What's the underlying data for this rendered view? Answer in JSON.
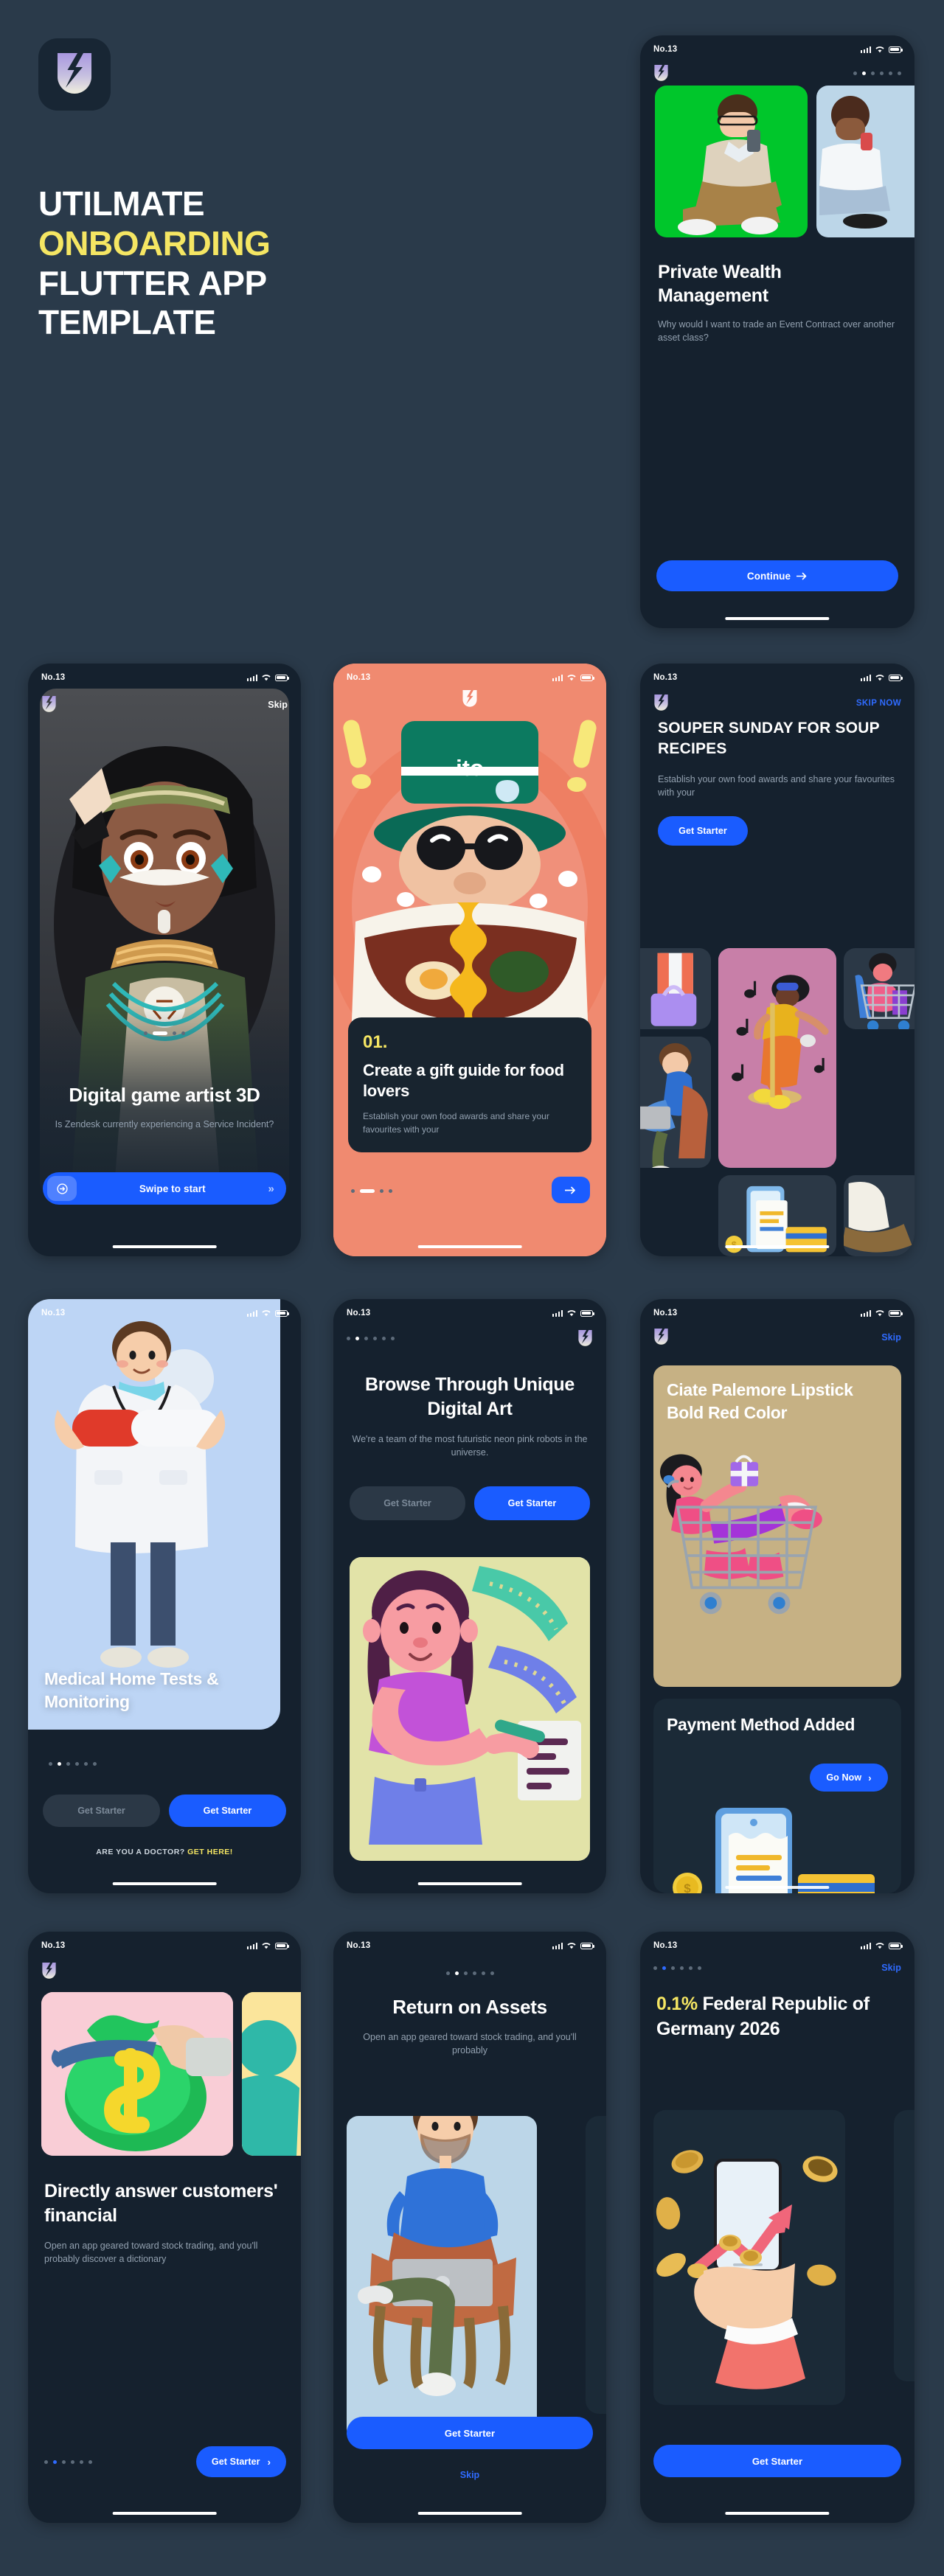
{
  "hero": {
    "logo_icon": "lightning-u-logo-icon",
    "title_line1": "UTILMATE",
    "title_line2": "ONBOARDING",
    "title_line3": "FLUTTER APP",
    "title_line4": "TEMPLATE",
    "accent_color": "#f5e663"
  },
  "theme": {
    "page_bg": "#2a3a4a",
    "phone_bg": "#15212e",
    "primary": "#1a5cff",
    "link_blue": "#2f6bff",
    "yellow": "#f5e663",
    "muted_text": "#93a1b0"
  },
  "status_bar": {
    "label": "No.13",
    "signal_icon": "signal-bars-icon",
    "wifi_icon": "wifi-icon",
    "battery_icon": "battery-full-icon"
  },
  "screens": [
    {
      "id": "private-wealth",
      "brand_icon": "app-logo-icon",
      "dots": {
        "count": 6,
        "active": 1
      },
      "gallery": [
        {
          "bg": "#00c62b",
          "label": "man-with-phone-green-card"
        },
        {
          "bg": "#bcd6e8",
          "label": "woman-with-phone-blue-card"
        }
      ],
      "title": "Private Wealth Management",
      "subtitle": "Why would I want to trade an Event Contract over another asset class?",
      "cta": {
        "label": "Continue",
        "icon": "arrow-right-icon"
      }
    },
    {
      "id": "digital-game-artist",
      "brand_icon": "app-logo-icon",
      "skip_label": "Skip",
      "hero_label": "native-girl-3d-portrait",
      "dots": {
        "count": 5,
        "active": 1,
        "style": "pill"
      },
      "title": "Digital game artist 3D",
      "subtitle": "Is Zendesk currently experiencing a Service Incident?",
      "cta": {
        "label": "Swipe to start",
        "lead_icon": "arrow-circle-right-icon",
        "trail_icon": "chevron-double-right-icon"
      }
    },
    {
      "id": "gift-guide-food",
      "brand_icon": "app-logo-icon",
      "hero_label": "ramen-man-with-bucket-hat-ito",
      "step": "01.",
      "title": "Create a gift guide for food lovers",
      "subtitle": "Establish your own food awards and share your favourites with your",
      "dots": {
        "count": 4,
        "active": 1,
        "style": "pill"
      },
      "next_button": {
        "icon": "arrow-right-icon"
      }
    },
    {
      "id": "souper-sunday",
      "brand_icon": "app-logo-icon",
      "skip_label": "SKIP NOW",
      "title": "SOUPER SUNDAY FOR SOUP RECIPES",
      "subtitle": "Establish your own food awards and share your favourites with your",
      "cta": {
        "label": "Get Starter"
      },
      "tiles": [
        {
          "bg": "#2b3846",
          "label": "shopping-bag-3d-tile"
        },
        {
          "bg": "#c87fa8",
          "label": "dancing-woman-music-tile"
        },
        {
          "bg": "#2b3846",
          "label": "woman-in-cart-tile"
        },
        {
          "bg": "#2b3846",
          "label": "man-on-chair-laptop-tile"
        },
        {
          "bg": "#2b3846",
          "label": "payment-card-phone-tile"
        },
        {
          "bg": "#2b3846",
          "label": "shoe-tile"
        }
      ]
    },
    {
      "id": "medical-home-tests",
      "hero_bg": "#bdd5f5",
      "hero_label": "doctor-with-pill-3d",
      "title": "Medical Home Tests & Monitoring",
      "dots": {
        "count": 6,
        "active": 2
      },
      "buttons": [
        {
          "label": "Get Starter",
          "variant": "ghost"
        },
        {
          "label": "Get Starter",
          "variant": "primary"
        }
      ],
      "footer_prefix": "ARE YOU A DOCTOR?",
      "footer_link": "GET HERE!"
    },
    {
      "id": "browse-digital-art",
      "brand_icon": "app-logo-icon",
      "dots": {
        "count": 6,
        "active": 2
      },
      "title": "Browse Through Unique Digital Art",
      "subtitle": "We're a team of the most futuristic neon pink robots in the universe.",
      "buttons": [
        {
          "label": "Get Starter",
          "variant": "ghost"
        },
        {
          "label": "Get Starter",
          "variant": "primary"
        }
      ],
      "image": {
        "bg": "#e2e3a8",
        "label": "girl-with-ruler-3d-card"
      }
    },
    {
      "id": "lipstick-payment",
      "brand_icon": "app-logo-icon",
      "skip_label": "Skip",
      "card": {
        "bg": "#c6b184",
        "title": "Ciate Palemore Lipstick Bold Red Color",
        "label": "woman-in-shopping-cart-3d"
      },
      "panel": {
        "title": "Payment Method Added",
        "cta": {
          "label": "Go Now",
          "icon": "chevron-right-icon"
        },
        "label": "phone-receipt-coin-card-3d"
      }
    },
    {
      "id": "directly-answer",
      "brand_icon": "app-logo-icon",
      "gallery": [
        {
          "bg": "#f9cdd6",
          "label": "money-bag-dollar-3d"
        },
        {
          "bg": "#fbe59b",
          "label": "yellow-card-3d"
        }
      ],
      "title": "Directly answer customers' financial",
      "subtitle": "Open an app geared toward stock trading, and you'll probably discover a dictionary",
      "dots": {
        "count": 6,
        "active": 2,
        "style": "blue"
      },
      "cta": {
        "label": "Get Starter",
        "icon": "chevron-right-icon"
      }
    },
    {
      "id": "return-on-assets",
      "dots": {
        "count": 6,
        "active": 2
      },
      "title": "Return on Assets",
      "subtitle": "Open an app geared toward stock trading, and you'll probably",
      "image": {
        "bg": "#bcd6e8",
        "label": "man-on-chair-with-laptop-3d"
      },
      "cta": {
        "label": "Get Starter"
      },
      "skip_label": "Skip"
    },
    {
      "id": "federal-germany",
      "dots": {
        "count": 6,
        "active": 2,
        "style": "blue"
      },
      "skip_label": "Skip",
      "title_accent": "0.1%",
      "title_rest": " Federal Republic of Germany 2026",
      "image": {
        "bg": "#1b2936",
        "label": "hand-phone-growth-chart-coins-3d"
      },
      "cta": {
        "label": "Get Starter"
      }
    }
  ]
}
